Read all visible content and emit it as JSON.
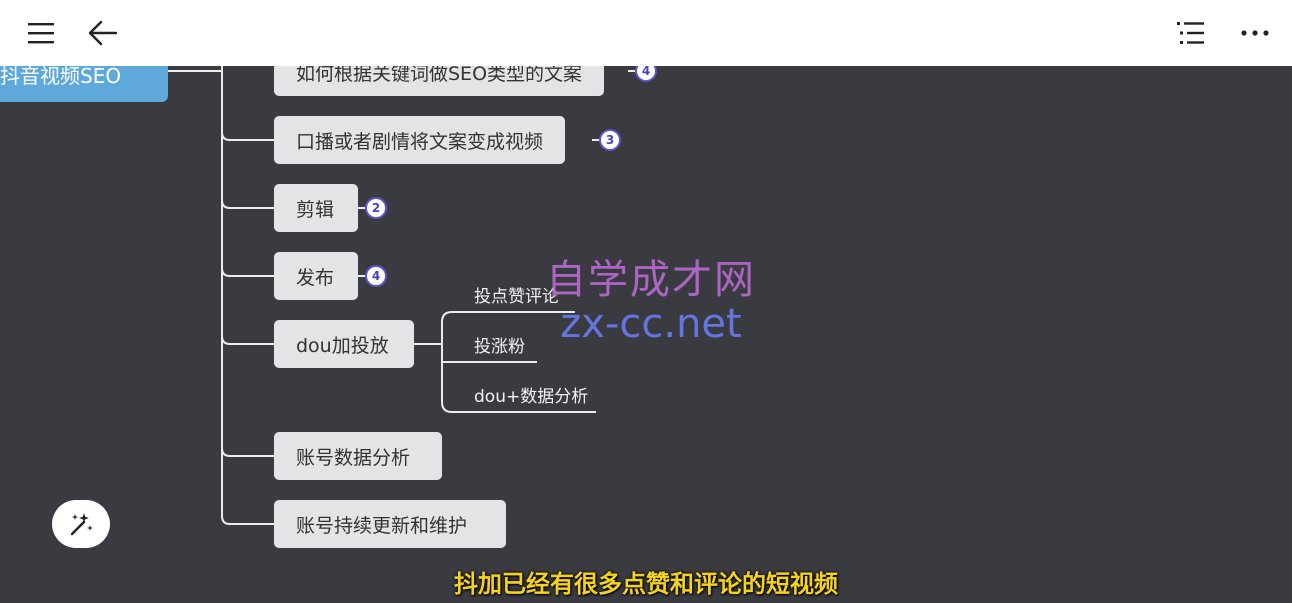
{
  "topbar": {
    "menu_icon": "hamburger-menu-icon",
    "back_icon": "arrow-left-icon",
    "outline_icon": "list-outline-icon",
    "more_icon": "more-horizontal-icon"
  },
  "mindmap": {
    "root": "抖音视频SEO",
    "nodes": [
      {
        "label": "如何根据关键词做SEO类型的文案",
        "badge": "4"
      },
      {
        "label": "口播或者剧情将文案变成视频",
        "badge": "3"
      },
      {
        "label": "剪辑",
        "badge": "2"
      },
      {
        "label": "发布",
        "badge": "4"
      },
      {
        "label": "dou加投放",
        "badge": ""
      },
      {
        "label": "账号数据分析",
        "badge": ""
      },
      {
        "label": "账号持续更新和维护",
        "badge": ""
      }
    ],
    "dou_children": [
      "投点赞评论",
      "投涨粉",
      "dou+数据分析"
    ]
  },
  "watermark": {
    "line1": "自学成才网",
    "line2": "zx-cc.net"
  },
  "subtitle": "抖加已经有很多点赞和评论的短视频",
  "colors": {
    "root": "#5fa8db",
    "badge_border": "#5b55c9",
    "subtitle": "#f4d21e",
    "canvas": "#3a3b41"
  }
}
